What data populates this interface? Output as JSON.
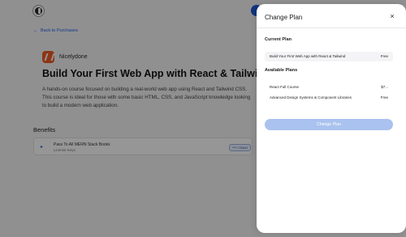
{
  "back_link": {
    "label": "Back to Purchases"
  },
  "product": {
    "vendor_name": "Nicelydone",
    "title": "Build Your First Web App with React & Tailwind",
    "description": "A hands-on course focused on building a real-world web app using React and Tailwind CSS. This course is ideal for those with some basic HTML, CSS, and JavaScript knowledge looking to build a modern web application."
  },
  "benefits": {
    "heading": "Benefits",
    "items": [
      {
        "name": "Pass To All MERN Stack Books",
        "type": "License Keys",
        "badge": "****-7DA4I"
      }
    ]
  },
  "modal": {
    "title": "Change Plan",
    "close_symbol": "×",
    "current_plan_label": "Current Plan",
    "current_plan": {
      "name": "Build Your First Web App with React & Tailwind",
      "price": "Free"
    },
    "available_plans_label": "Available Plans",
    "available_plans": [
      {
        "name": "React Full Course",
        "price": "$7..."
      },
      {
        "name": "Advanced Design Systems & Component Libraries",
        "price": "Free"
      }
    ],
    "change_button_label": "Change Plan"
  },
  "colors": {
    "accent": "#2563eb",
    "vendor_brand": "#ef5a24",
    "button_disabled": "#a9c2ef",
    "overlay": "rgba(0,0,0,0.41)"
  },
  "icons": {
    "logo": "app-logo-icon",
    "back": "arrow-left-icon",
    "benefit": "chevron-right-icon",
    "close": "close-icon"
  }
}
